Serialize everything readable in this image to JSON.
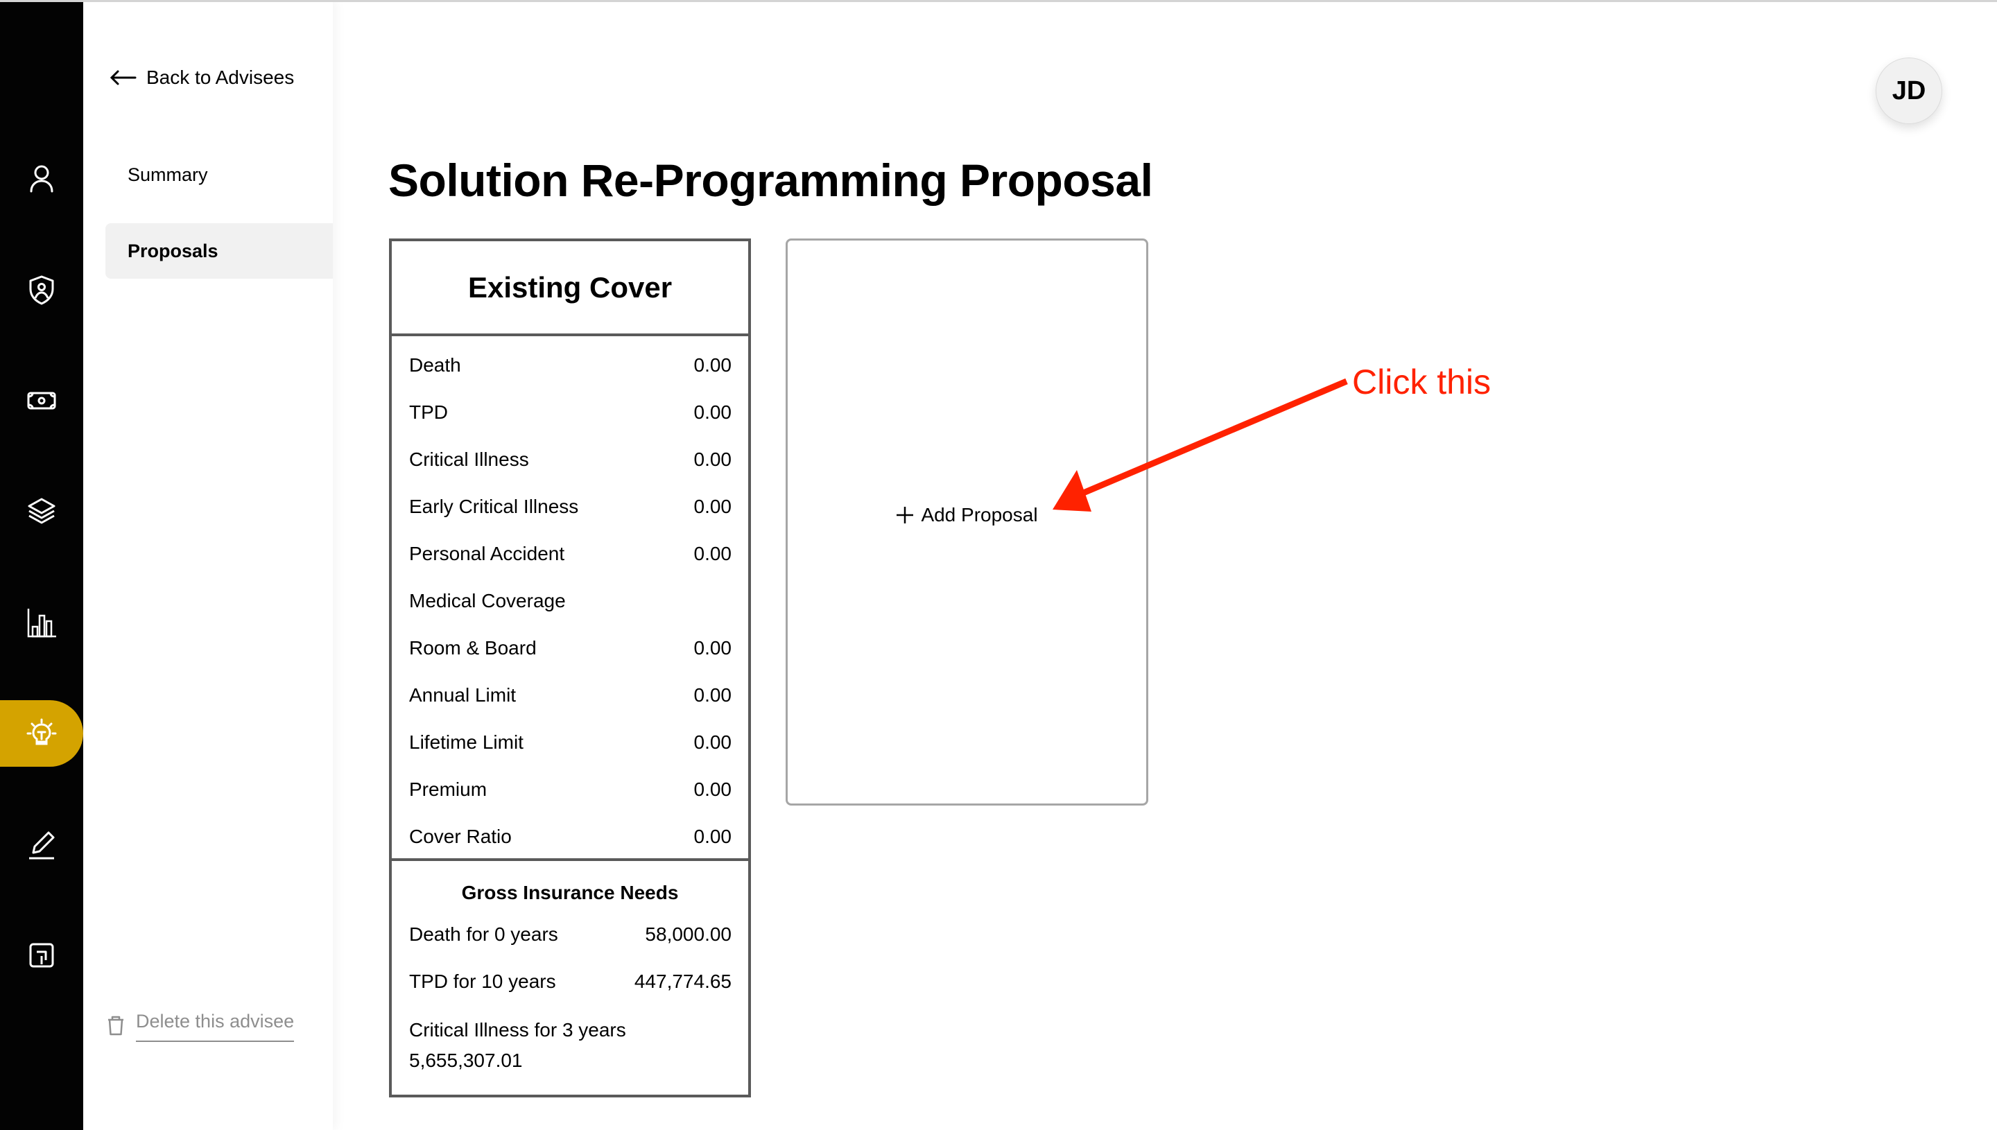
{
  "rail": {
    "items": [
      {
        "icon": "person-icon",
        "active": false
      },
      {
        "icon": "shield-person-icon",
        "active": false
      },
      {
        "icon": "money-icon",
        "active": false
      },
      {
        "icon": "layers-icon",
        "active": false
      },
      {
        "icon": "bar-chart-icon",
        "active": false
      },
      {
        "icon": "lightbulb-icon",
        "active": true
      },
      {
        "icon": "pencil-icon",
        "active": false
      },
      {
        "icon": "export-icon",
        "active": false
      }
    ],
    "active_color": "#D4A300"
  },
  "subnav": {
    "back_label": "Back to Advisees",
    "items": [
      {
        "label": "Summary",
        "active": false
      },
      {
        "label": "Proposals",
        "active": true
      }
    ],
    "delete_label": "Delete this advisee"
  },
  "header": {
    "avatar_initials": "JD"
  },
  "main": {
    "title": "Solution Re-Programming Proposal",
    "existing_cover": {
      "title": "Existing Cover",
      "rows": [
        {
          "label": "Death",
          "value": "0.00"
        },
        {
          "label": "TPD",
          "value": "0.00"
        },
        {
          "label": "Critical Illness",
          "value": "0.00"
        },
        {
          "label": "Early Critical Illness",
          "value": "0.00"
        },
        {
          "label": "Personal Accident",
          "value": "0.00"
        },
        {
          "label": "Medical Coverage",
          "value": ""
        },
        {
          "label": "Room & Board",
          "value": "0.00"
        },
        {
          "label": "Annual Limit",
          "value": "0.00"
        },
        {
          "label": "Lifetime Limit",
          "value": "0.00"
        },
        {
          "label": "Premium",
          "value": "0.00"
        },
        {
          "label": "Cover Ratio",
          "value": "0.00"
        }
      ],
      "gross_needs": {
        "title": "Gross Insurance Needs",
        "rows": [
          {
            "label": "Death for 0 years",
            "value": "58,000.00"
          },
          {
            "label": "TPD for 10 years",
            "value": "447,774.65"
          }
        ],
        "wrapped": {
          "label": "Critical Illness for 3 years",
          "value": "5,655,307.01"
        }
      }
    },
    "add_proposal_label": "Add Proposal"
  },
  "annotation": {
    "text": "Click this",
    "color": "#FF2200"
  }
}
